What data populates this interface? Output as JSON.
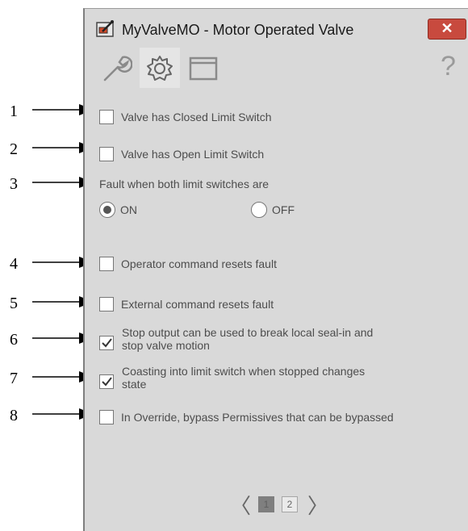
{
  "window": {
    "title": "MyValveMO - Motor Operated Valve",
    "close": "✕",
    "help": "?"
  },
  "tabs": [
    {
      "name": "maintenance-tab"
    },
    {
      "name": "configuration-tab",
      "active": true
    },
    {
      "name": "display-tab"
    }
  ],
  "callouts": [
    "1",
    "2",
    "3",
    "4",
    "5",
    "6",
    "7",
    "8"
  ],
  "options": {
    "closed_limit": {
      "label": "Valve has Closed Limit Switch",
      "checked": false
    },
    "open_limit": {
      "label": "Valve has Open Limit Switch",
      "checked": false
    },
    "fault_heading": "Fault when both limit switches are",
    "radio_on": {
      "label": "ON",
      "selected": true
    },
    "radio_off": {
      "label": "OFF",
      "selected": false
    },
    "operator_reset": {
      "label": "Operator command resets fault",
      "checked": false
    },
    "external_reset": {
      "label": "External command resets fault",
      "checked": false
    },
    "stop_seal": {
      "label_line1": "Stop output can be used to break local seal-in and",
      "label_line2": "stop valve motion",
      "checked": true
    },
    "coasting": {
      "label_line1": "Coasting into limit switch when stopped changes",
      "label_line2": "state",
      "checked": true
    },
    "override_bypass": {
      "label": "In Override, bypass Permissives that can be bypassed",
      "checked": false
    }
  },
  "pager": {
    "prev": "〈",
    "next": "〉",
    "pages": [
      "1",
      "2"
    ],
    "current": "1"
  }
}
